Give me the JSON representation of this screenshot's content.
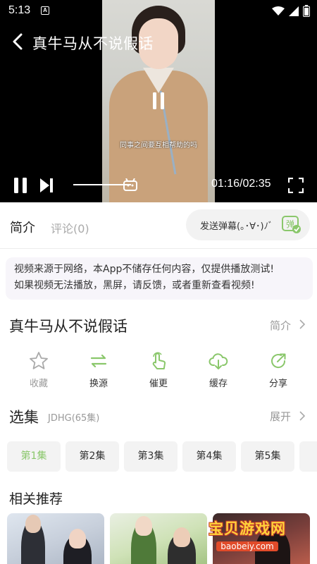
{
  "status_bar": {
    "time": "5:13",
    "app_badge": "A"
  },
  "video": {
    "title": "真牛马从不说假话",
    "subtitle": "同事之间要互相帮助的吗",
    "time_display": "01:16/02:35",
    "progress": 0.49
  },
  "tabs": {
    "intro": "简介",
    "comments": "评论(0)"
  },
  "danmaku": {
    "placeholder": "发送弹幕(｡･∀･)ﾉﾞ",
    "icon_text": "弹"
  },
  "notice": {
    "line1": "视频来源于网络，本App不储存任何内容，仅提供播放测试!",
    "line2": "如果视频无法播放，黑屏，请反馈，或者重新查看视频!"
  },
  "info": {
    "title": "真牛马从不说假话",
    "intro_link": "简介"
  },
  "actions": [
    {
      "label": "收藏",
      "icon": "star-icon"
    },
    {
      "label": "换源",
      "icon": "switch-icon"
    },
    {
      "label": "催更",
      "icon": "urge-icon"
    },
    {
      "label": "缓存",
      "icon": "download-cloud-icon"
    },
    {
      "label": "分享",
      "icon": "share-icon"
    }
  ],
  "episodes": {
    "heading": "选集",
    "sub": "JDHG(65集)",
    "expand": "展开",
    "items": [
      "第1集",
      "第2集",
      "第3集",
      "第4集",
      "第5集"
    ],
    "active_index": 0
  },
  "related": {
    "heading": "相关推荐"
  },
  "watermark": {
    "big": "宝贝游戏网",
    "small": "baobeiy.com"
  },
  "colors": {
    "accent": "#8ac76b",
    "muted": "#999999"
  }
}
